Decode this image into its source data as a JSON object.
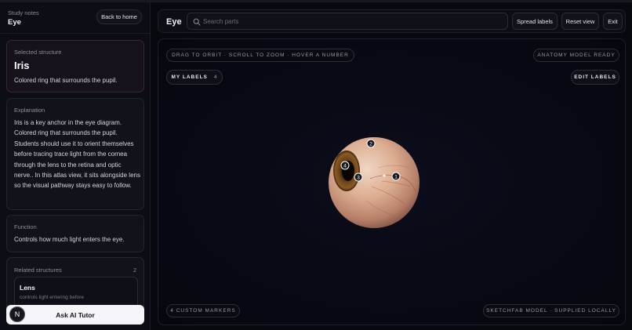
{
  "sidebar": {
    "kicker": "Study notes",
    "title": "Eye",
    "back_label": "Back to home",
    "selected": {
      "kicker": "Selected structure",
      "name": "Iris",
      "summary": "Colored ring that surrounds the pupil."
    },
    "explanation": {
      "kicker": "Explanation",
      "text": "Iris is a key anchor in the eye diagram. Colored ring that surrounds the pupil. Students should use it to orient themselves before tracing trace light from the cornea through the lens to the retina and optic nerve.. In this atlas view, it sits alongside lens so the visual pathway stays easy to follow."
    },
    "function": {
      "kicker": "Function",
      "text": "Controls how much light enters the eye."
    },
    "related": {
      "kicker": "Related structures",
      "count": "2",
      "items": [
        {
          "name": "Lens",
          "desc": "controls light entering before"
        }
      ]
    },
    "tutor": {
      "avatar": "N",
      "label": "Ask AI Tutor"
    }
  },
  "header": {
    "title": "Eye",
    "search_placeholder": "Search parts",
    "spread_label": "Spread labels",
    "reset_label": "Reset view",
    "exit_label": "Exit"
  },
  "viewer": {
    "hint": "DRAG TO ORBIT · SCROLL TO ZOOM · HOVER A NUMBER",
    "status": "ANATOMY MODEL READY",
    "my_labels": "MY LABELS",
    "my_labels_count": "4",
    "edit_labels": "EDIT LABELS",
    "markers_count": "4 CUSTOM MARKERS",
    "source": "SKETCHFAB MODEL · SUPPLIED LOCALLY",
    "markers": [
      "1",
      "2",
      "3",
      "4"
    ]
  },
  "colors": {
    "accent_card": "#17111b",
    "background": "#08080f",
    "panel": "#0d0d15"
  }
}
